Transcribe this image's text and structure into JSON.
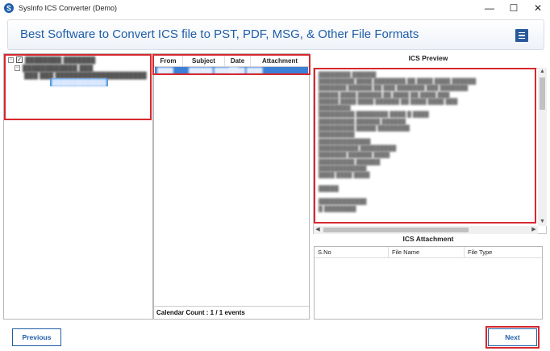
{
  "window": {
    "title": "SysInfo ICS Converter (Demo)",
    "controls": {
      "minimize": "—",
      "maximize": "☐",
      "close": "✕"
    }
  },
  "banner": {
    "title": "Best Software to Convert ICS file to PST, PDF, MSG, & Other File Formats"
  },
  "tree": {
    "root_label": "████████ ███████",
    "child_label": "████████████ ███",
    "grandchild_label": "███ ███ ████████████████████",
    "selected_label": "████████████"
  },
  "list": {
    "columns": [
      "From",
      "Subject",
      "Date",
      "Attachment"
    ],
    "row": {
      "from": "████",
      "subject": "██████ ██████",
      "date": "████ ████"
    },
    "footer": "Calendar Count : 1 / 1 events"
  },
  "preview": {
    "title": "ICS Preview",
    "lines": [
      "████████ ██████",
      "█████████ ████ ████████ ██ ████ ████ ██████",
      "███████ ██████ ██ ███ ███████ ███ ███████",
      "█████ ████ ██████ ██ ████ ██ ████ ███",
      "█████ ████ ████ ██████ ██ ████ ████ ███",
      "████████",
      "█████████ ████████ ████ █ ████",
      "█████████ ██████ ██████",
      "█████████ █████ ████████",
      "█████████",
      "█████████████",
      "██████████ █████████",
      "███████ ██████ ████",
      "█████████ ██████",
      "████████████",
      "████ ████ ████",
      "",
      "█████",
      "",
      "████████████",
      "█ ████████"
    ]
  },
  "attachment": {
    "title": "ICS Attachment",
    "columns": [
      "S.No",
      "File Name",
      "File Type"
    ]
  },
  "buttons": {
    "previous": "Previous",
    "next": "Next"
  },
  "colors": {
    "accent": "#1f5ea8",
    "highlight_border": "#d7282e",
    "selection": "#3b7fd6"
  }
}
